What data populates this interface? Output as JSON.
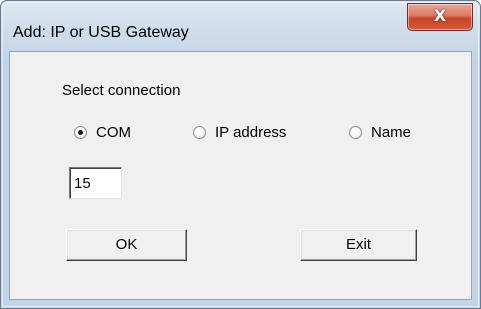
{
  "window": {
    "title": "Add: IP or USB Gateway",
    "close_icon": "close-icon",
    "close_glyph": "X"
  },
  "connection": {
    "label": "Select connection",
    "options": [
      {
        "label": "COM",
        "selected": true
      },
      {
        "label": "IP address",
        "selected": false
      },
      {
        "label": "Name",
        "selected": false
      }
    ],
    "value": "15"
  },
  "buttons": {
    "ok_label": "OK",
    "exit_label": "Exit"
  },
  "colors": {
    "frame": "#c4d4e6",
    "close_button": "#c7442a",
    "client_background": "#f0f0f0"
  }
}
